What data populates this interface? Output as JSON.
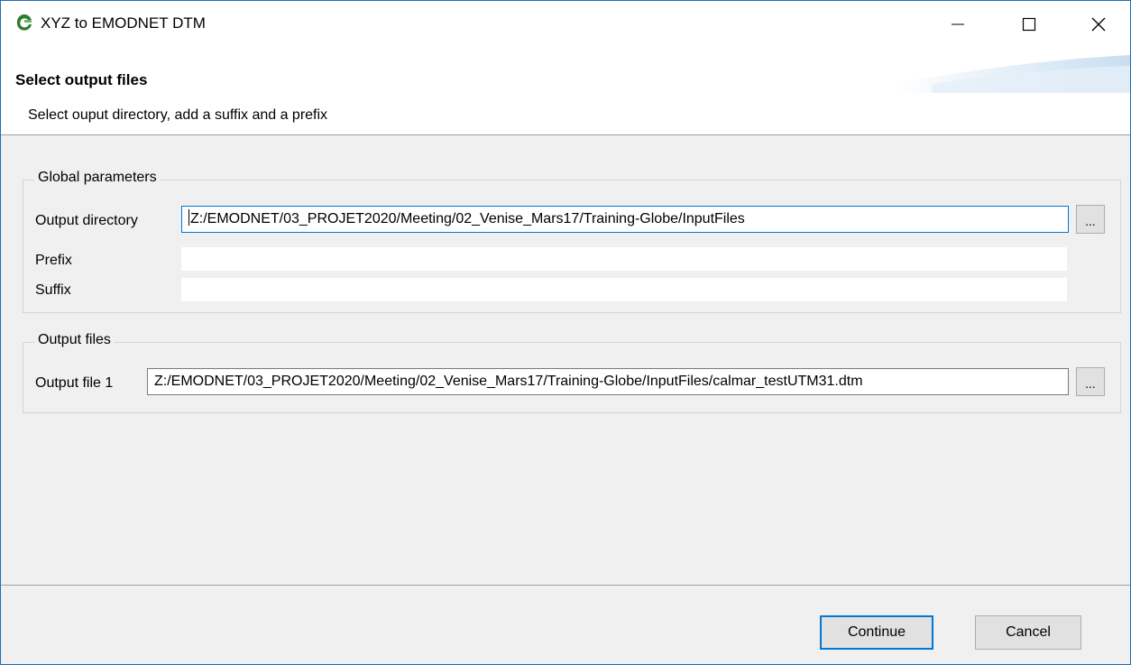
{
  "window": {
    "title": "XYZ to EMODNET DTM",
    "icons": {
      "app": "globe-g-icon",
      "minimize": "minimize-icon",
      "maximize": "maximize-icon",
      "close": "close-icon"
    },
    "colors": {
      "frame": "#1f6fb2",
      "focus": "#0078d7",
      "background": "#f0f0f0"
    }
  },
  "header": {
    "title": "Select output files",
    "description": "Select ouput directory, add a suffix and a prefix"
  },
  "global_parameters": {
    "legend": "Global parameters",
    "output_directory_label": "Output directory",
    "output_directory_value": "Z:/EMODNET/03_PROJET2020/Meeting/02_Venise_Mars17/Training-Globe/InputFiles",
    "prefix_label": "Prefix",
    "prefix_value": "",
    "suffix_label": "Suffix",
    "suffix_value": "",
    "browse_label": "..."
  },
  "output_files": {
    "legend": "Output files",
    "file1_label": "Output file 1",
    "file1_value": "Z:/EMODNET/03_PROJET2020/Meeting/02_Venise_Mars17/Training-Globe/InputFiles/calmar_testUTM31.dtm",
    "browse_label": "..."
  },
  "buttons": {
    "continue": "Continue",
    "cancel": "Cancel"
  }
}
